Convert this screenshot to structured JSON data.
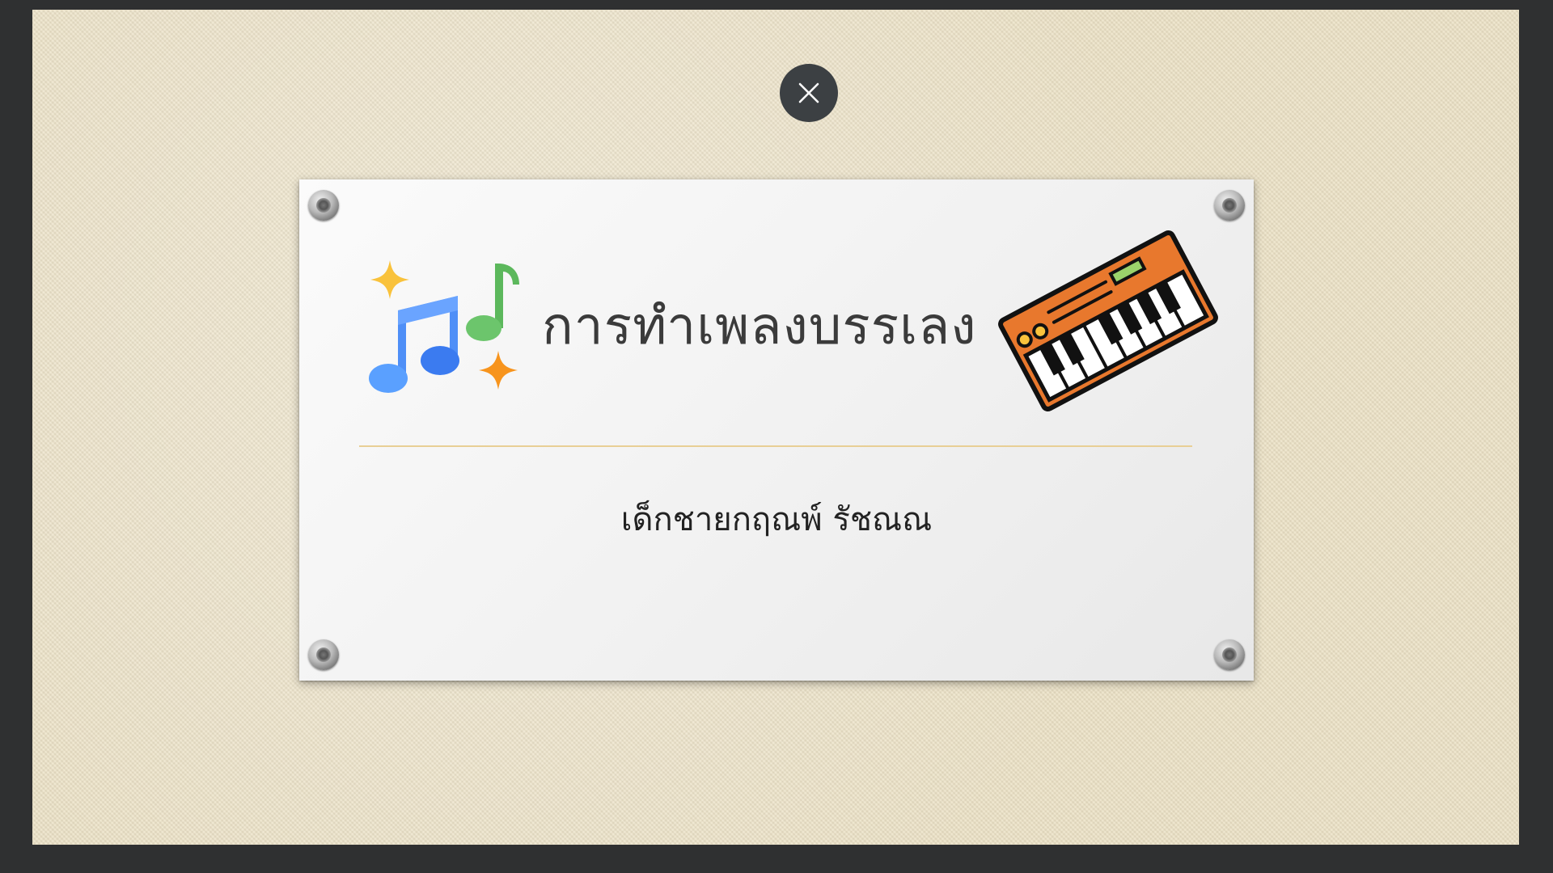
{
  "slide": {
    "title": "การทำเพลงบรรเลง",
    "subtitle": "เด็กชายกฤณพ์ รัชณณ"
  },
  "controls": {
    "close_icon": "close-icon"
  },
  "icons": {
    "music_notes": "music-notes-sparkle-icon",
    "keyboard": "synthesizer-keyboard-icon"
  },
  "colors": {
    "background_frame": "#2f3031",
    "canvas": "#ece2c6",
    "card": "#f4f4f4",
    "divider": "#e8cf95",
    "close_button": "#3c4043",
    "note_blue": "#4f8ff7",
    "note_green": "#5cb85c",
    "sparkle_yellow": "#f9c23c",
    "sparkle_orange": "#f7941d",
    "keyboard_orange": "#e8782d"
  }
}
